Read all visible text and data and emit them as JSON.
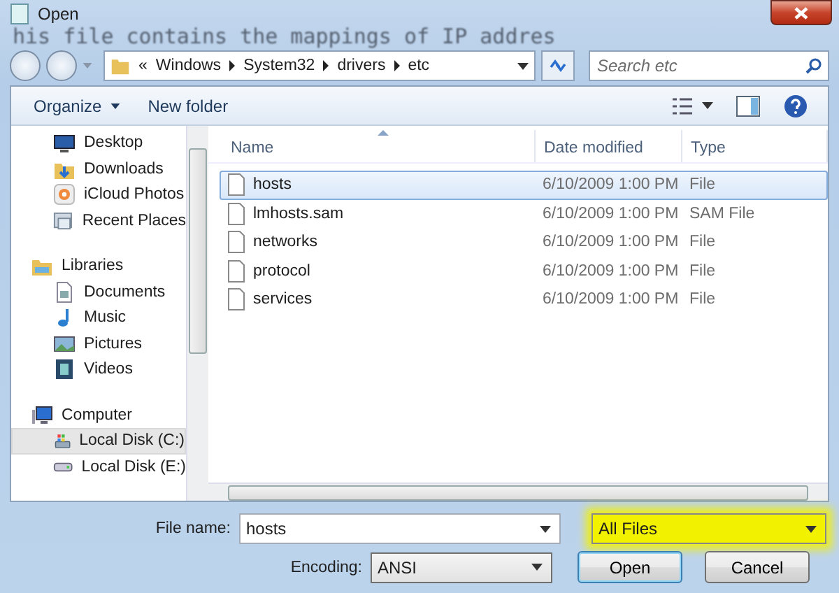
{
  "window": {
    "title": "Open"
  },
  "background_text": "his file contains the mappings of IP addres",
  "address_bar": {
    "overflow": "«",
    "crumbs": [
      "Windows",
      "System32",
      "drivers",
      "etc"
    ]
  },
  "search": {
    "placeholder": "Search etc"
  },
  "toolbar": {
    "buttons": [
      {
        "label": "Organize",
        "dropdown": true
      },
      {
        "label": "New folder",
        "dropdown": false
      }
    ]
  },
  "nav": {
    "tree": [
      {
        "children": [
          {
            "label": "Desktop",
            "kind": "desktop",
            "selected": false
          },
          {
            "label": "Downloads",
            "kind": "downloads",
            "selected": false
          },
          {
            "label": "iCloud Photos",
            "kind": "photos",
            "selected": false
          },
          {
            "label": "Recent Places",
            "kind": "recent",
            "selected": false
          }
        ]
      },
      {
        "label": "Libraries",
        "kind": "library",
        "selected": false,
        "children": [
          {
            "label": "Documents",
            "kind": "document",
            "selected": false
          },
          {
            "label": "Music",
            "kind": "music",
            "selected": false
          },
          {
            "label": "Pictures",
            "kind": "picture",
            "selected": false
          },
          {
            "label": "Videos",
            "kind": "video",
            "selected": false
          }
        ]
      },
      {
        "label": "Computer",
        "kind": "computer",
        "selected": false,
        "children": [
          {
            "label": "Local Disk (C:)",
            "kind": "system-disk",
            "selected": true
          },
          {
            "label": "Local Disk (E:)",
            "kind": "disk",
            "selected": false
          }
        ]
      }
    ]
  },
  "files": {
    "columns": [
      {
        "label": "Name",
        "sorted": true
      },
      {
        "label": "Date modified",
        "sorted": false
      },
      {
        "label": "Type",
        "sorted": false
      }
    ],
    "rows": [
      {
        "name": "hosts",
        "date": "6/10/2009 1:00 PM",
        "type": "File",
        "selected": true
      },
      {
        "name": "lmhosts.sam",
        "date": "6/10/2009 1:00 PM",
        "type": "SAM File",
        "selected": false
      },
      {
        "name": "networks",
        "date": "6/10/2009 1:00 PM",
        "type": "File",
        "selected": false
      },
      {
        "name": "protocol",
        "date": "6/10/2009 1:00 PM",
        "type": "File",
        "selected": false
      },
      {
        "name": "services",
        "date": "6/10/2009 1:00 PM",
        "type": "File",
        "selected": false
      }
    ]
  },
  "file_name": {
    "label": "File name:",
    "value": "hosts"
  },
  "file_type": {
    "value": "All Files",
    "highlighted": true
  },
  "encoding": {
    "label": "Encoding:",
    "value": "ANSI"
  },
  "buttons": [
    {
      "label": "Open",
      "default": true
    },
    {
      "label": "Cancel",
      "default": false
    }
  ]
}
